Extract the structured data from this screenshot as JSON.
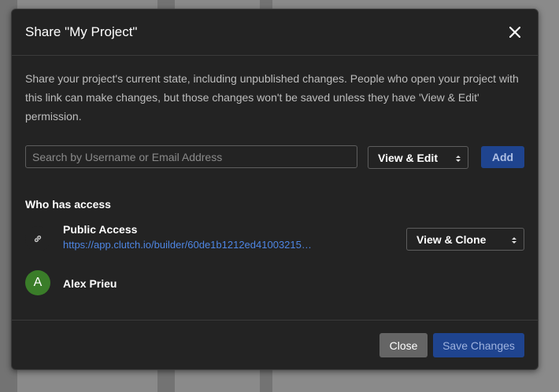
{
  "dialog": {
    "title": "Share \"My Project\"",
    "description": "Share your project's current state, including unpublished changes. People who open your project with this link can make changes, but those changes won't be saved unless they have 'View & Edit' permission."
  },
  "invite": {
    "search_placeholder": "Search by Username or Email Address",
    "permission_value": "View & Edit",
    "add_label": "Add"
  },
  "access": {
    "heading": "Who has access",
    "public": {
      "title": "Public Access",
      "link": "https://app.clutch.io/builder/60de1b1212ed41003215…",
      "permission_value": "View & Clone",
      "icon": "link-icon"
    },
    "users": [
      {
        "initial": "A",
        "name": "Alex Prieu",
        "avatar_color": "#3a7d29"
      }
    ]
  },
  "footer": {
    "close_label": "Close",
    "save_label": "Save Changes"
  },
  "colors": {
    "primary": "#1f448f",
    "link": "#4e86e4",
    "dialog_bg": "#232323"
  }
}
